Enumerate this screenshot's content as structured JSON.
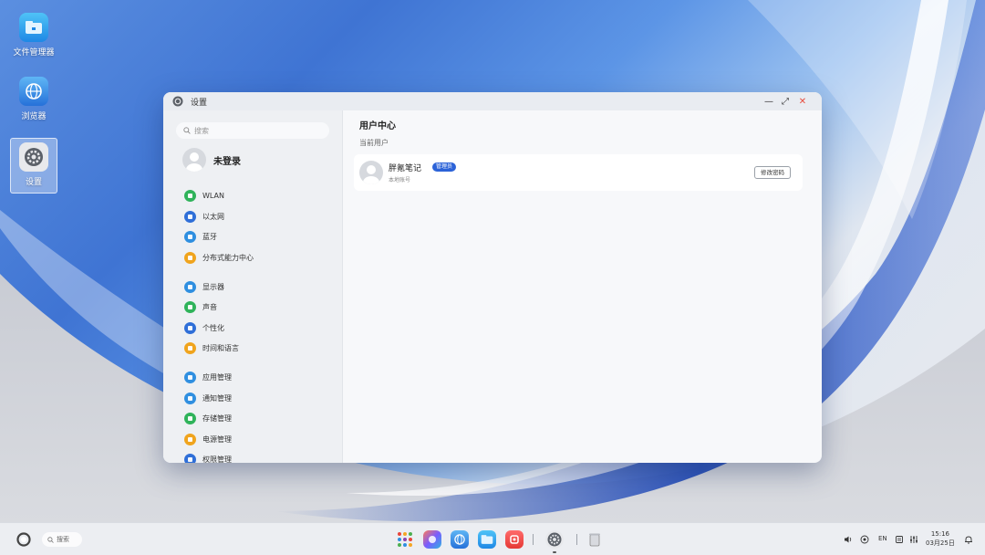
{
  "desktop": {
    "icons": [
      {
        "label": "文件管理器"
      },
      {
        "label": "浏览器"
      },
      {
        "label": "设置"
      }
    ]
  },
  "window": {
    "title": "设置",
    "controls": {
      "minimize": "—",
      "maximize": "⤢",
      "close": "✕"
    }
  },
  "sidebar": {
    "search_placeholder": "搜索",
    "account_name": "未登录",
    "items": [
      {
        "label": "WLAN",
        "color": "#2fb35a"
      },
      {
        "label": "以太网",
        "color": "#2f6fd8"
      },
      {
        "label": "蓝牙",
        "color": "#2f8fe0"
      },
      {
        "label": "分布式能力中心",
        "color": "#f0a41d"
      },
      {
        "label": "显示器",
        "color": "#2f8fe0"
      },
      {
        "label": "声音",
        "color": "#2fb35a"
      },
      {
        "label": "个性化",
        "color": "#2f6fd8"
      },
      {
        "label": "时间和语言",
        "color": "#f0a41d"
      },
      {
        "label": "应用管理",
        "color": "#2f8fe0"
      },
      {
        "label": "通知管理",
        "color": "#2f8fe0"
      },
      {
        "label": "存储管理",
        "color": "#2fb35a"
      },
      {
        "label": "电源管理",
        "color": "#f0a41d"
      },
      {
        "label": "权限管理",
        "color": "#2f6fd8"
      }
    ]
  },
  "content": {
    "title": "用户中心",
    "section": "当前用户",
    "user": {
      "name": "胖氪笔记",
      "badge": "管理员",
      "type": "本地账号",
      "edit_label": "修改密码"
    }
  },
  "taskbar": {
    "search_label": "搜索",
    "input_method": "EN",
    "time": "15:16",
    "date": "03月25日"
  },
  "colors": {
    "accent": "#2c63d8",
    "close": "#e84c3d"
  }
}
